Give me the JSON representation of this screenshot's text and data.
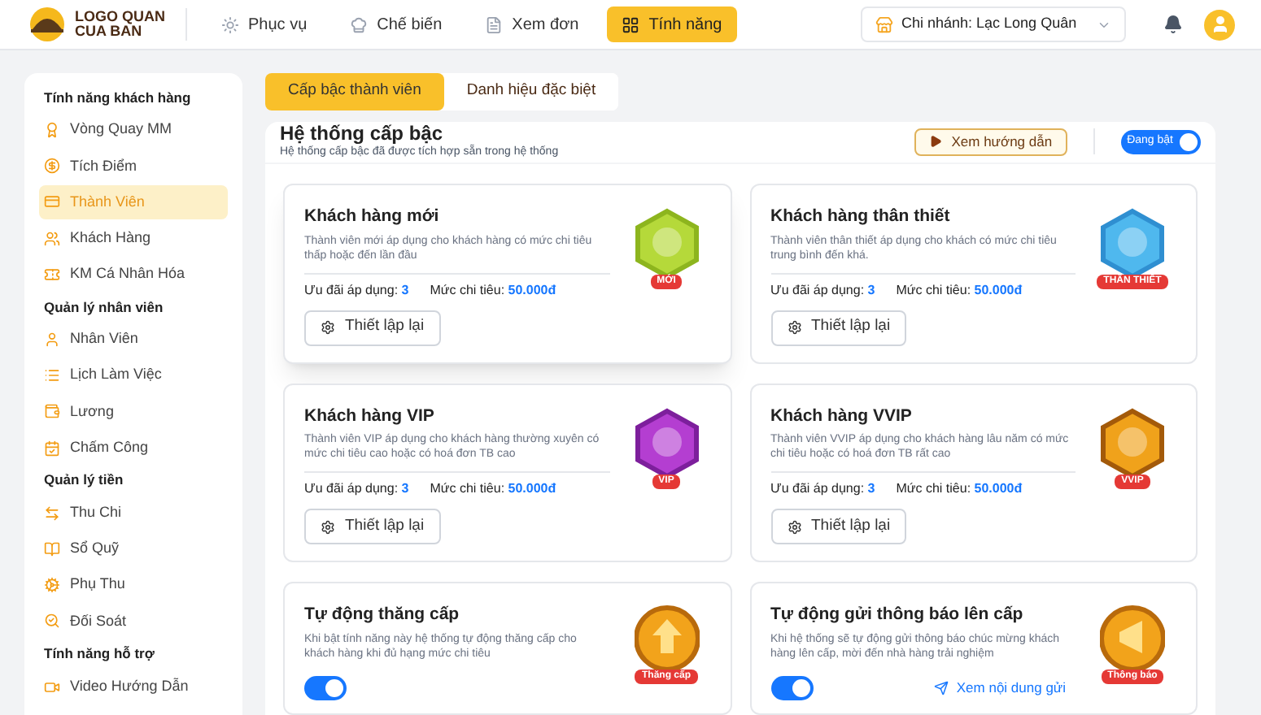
{
  "logo": {
    "line_1": "LOGO QUAN",
    "line_2": "CUA BAN"
  },
  "nav": [
    {
      "label": "Phục vụ",
      "selected": false
    },
    {
      "label": "Chế biến",
      "selected": false
    },
    {
      "label": "Xem đơn",
      "selected": false
    },
    {
      "label": "Tính năng",
      "selected": true
    }
  ],
  "branch": {
    "label": "Chi nhánh: Lạc Long Quân"
  },
  "sidebar": {
    "groups": [
      {
        "title": "Tính năng khách hàng",
        "items": [
          {
            "label": "Vòng Quay MM",
            "selected": false
          },
          {
            "label": "Tích Điểm",
            "selected": false
          },
          {
            "label": "Thành Viên",
            "selected": true
          },
          {
            "label": "Khách Hàng",
            "selected": false
          },
          {
            "label": "KM Cá Nhân Hóa",
            "selected": false
          }
        ]
      },
      {
        "title": "Quản lý nhân viên",
        "items": [
          {
            "label": "Nhân Viên",
            "selected": false
          },
          {
            "label": "Lịch Làm Việc",
            "selected": false
          },
          {
            "label": "Lương",
            "selected": false
          },
          {
            "label": "Chấm Công",
            "selected": false
          }
        ]
      },
      {
        "title": "Quản lý tiền",
        "items": [
          {
            "label": "Thu Chi",
            "selected": false
          },
          {
            "label": "Sổ Quỹ",
            "selected": false
          },
          {
            "label": "Phụ Thu",
            "selected": false
          },
          {
            "label": "Đối Soát",
            "selected": false
          }
        ]
      },
      {
        "title": "Tính năng hỗ trợ",
        "items": [
          {
            "label": "Video Hướng Dẫn",
            "selected": false
          }
        ]
      }
    ]
  },
  "tabs": [
    {
      "label": "Cấp bậc thành viên",
      "selected": true
    },
    {
      "label": "Danh hiệu đặc biệt",
      "selected": false
    }
  ],
  "panel": {
    "title": "Hệ thống cấp bậc",
    "subtitle": "Hệ thống cấp bậc đã được tích hợp sẵn trong hệ thống",
    "guide_button": "Xem hướng dẫn",
    "toggle": {
      "label": "Đang bật",
      "on": true
    }
  },
  "tiers": [
    {
      "title": "Khách hàng mới",
      "description": "Thành viên mới áp dụng cho khách hàng có mức chi tiêu thấp hoặc đến lần đầu",
      "offers_label": "Ưu đãi áp dụng:",
      "offers": "3",
      "spend_label": "Mức chi tiêu:",
      "spend": "50.000đ",
      "button": "Thiết lập lại",
      "badge": {
        "kind": "new",
        "ribbon": "MỚI"
      },
      "selected": true
    },
    {
      "title": "Khách hàng thân thiết",
      "description": "Thành viên thân thiết áp dụng cho khách có mức chi tiêu trung bình đến khá.",
      "offers_label": "Ưu đãi áp dụng:",
      "offers": "3",
      "spend_label": "Mức chi tiêu:",
      "spend": "50.000đ",
      "button": "Thiết lập lại",
      "badge": {
        "kind": "loyal",
        "ribbon": "THÂN THIẾT"
      },
      "selected": false
    },
    {
      "title": "Khách hàng VIP",
      "description": "Thành viên VIP áp dụng cho khách hàng thường xuyên có mức chi tiêu cao hoặc có hoá đơn TB cao",
      "offers_label": "Ưu đãi áp dụng:",
      "offers": "3",
      "spend_label": "Mức chi tiêu:",
      "spend": "50.000đ",
      "button": "Thiết lập lại",
      "badge": {
        "kind": "vip",
        "ribbon": "VIP"
      },
      "selected": false
    },
    {
      "title": "Khách hàng VVIP",
      "description": "Thành viên VVIP áp dụng cho khách hàng lâu năm có mức chi tiêu hoặc có hoá đơn TB rất cao",
      "offers_label": "Ưu đãi áp dụng:",
      "offers": "3",
      "spend_label": "Mức chi tiêu:",
      "spend": "50.000đ",
      "button": "Thiết lập lại",
      "badge": {
        "kind": "vvip",
        "ribbon": "VVIP"
      },
      "selected": false
    }
  ],
  "automations": [
    {
      "title": "Tự động thăng cấp",
      "description": "Khi bật tính năng này hệ thống tự động thăng cấp cho khách hàng khi đủ hạng mức chi tiêu",
      "on": true,
      "badge": {
        "kind": "up",
        "ribbon": "Thăng cấp"
      }
    },
    {
      "title": "Tự động gửi thông báo lên cấp",
      "description": "Khi hệ thống sẽ tự động gửi thông báo chúc mừng khách hàng lên cấp, mời đến nhà hàng trải nghiệm",
      "on": true,
      "link": "Xem nội dung gửi",
      "badge": {
        "kind": "notify",
        "ribbon": "Thông báo"
      }
    }
  ]
}
